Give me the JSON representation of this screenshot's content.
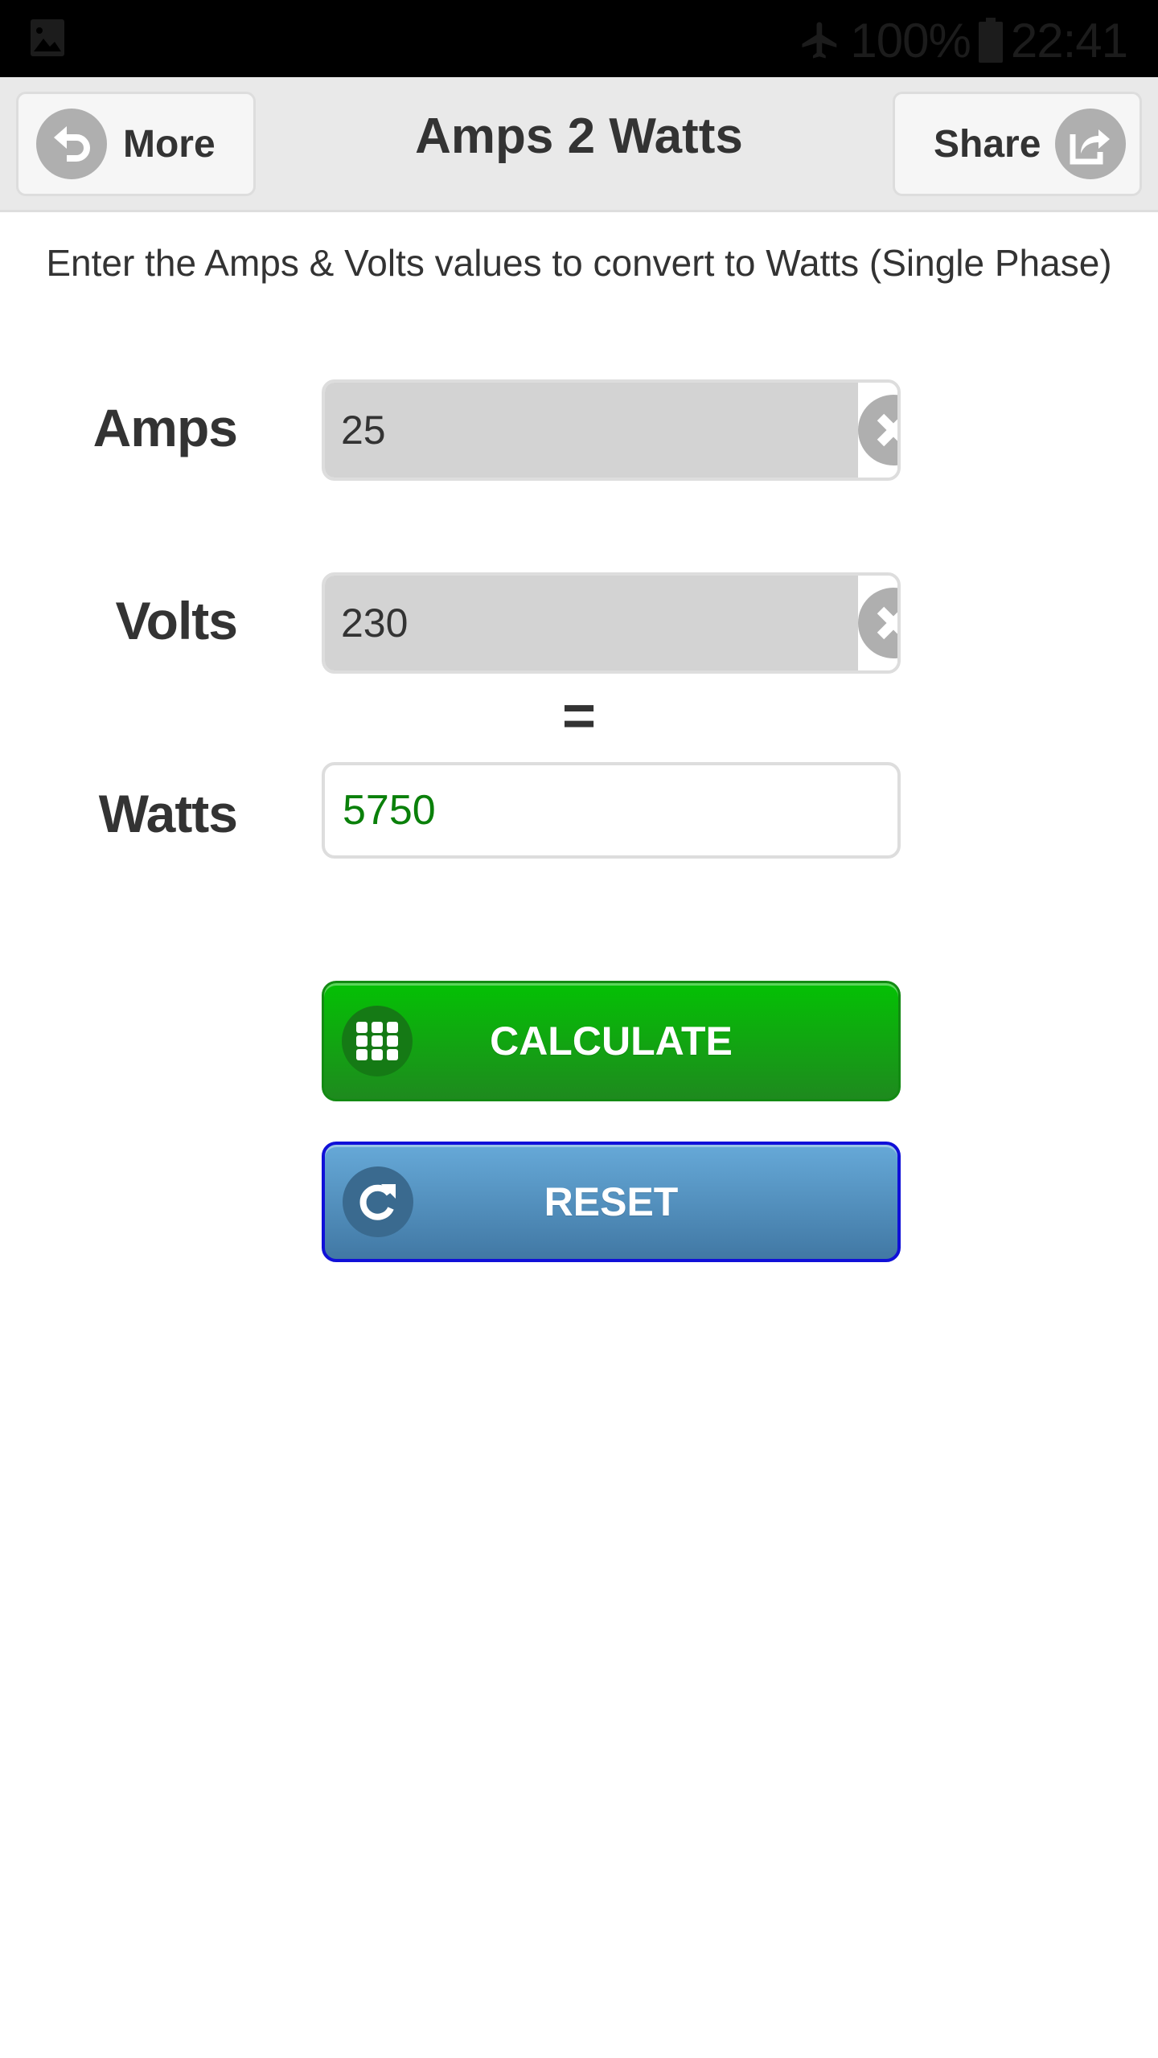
{
  "status_bar": {
    "left_icon": "gallery-notification-icon",
    "airplane_icon": "airplane-mode-icon",
    "battery_percent": "100%",
    "battery_icon": "battery-icon",
    "time": "22:41"
  },
  "header": {
    "title": "Amps 2 Watts",
    "more_button": {
      "label": "More",
      "icon": "undo-arrow-icon"
    },
    "share_button": {
      "label": "Share",
      "icon": "share-icon"
    }
  },
  "instruction": "Enter the Amps & Volts values to convert to Watts (Single Phase)",
  "form": {
    "amps": {
      "label": "Amps",
      "value": "25",
      "clear_icon": "clear-icon"
    },
    "volts": {
      "label": "Volts",
      "value": "230",
      "clear_icon": "clear-icon"
    },
    "equals": "=",
    "watts": {
      "label": "Watts",
      "value": "5750"
    }
  },
  "actions": {
    "calculate": {
      "label": "CALCULATE",
      "icon": "keypad-icon",
      "color": "#04c104"
    },
    "reset": {
      "label": "RESET",
      "icon": "refresh-icon",
      "color": "#5b9fd0"
    }
  },
  "colors": {
    "result_text": "#0a800a",
    "calculate_border": "#138a13",
    "reset_border": "#1010d8"
  }
}
